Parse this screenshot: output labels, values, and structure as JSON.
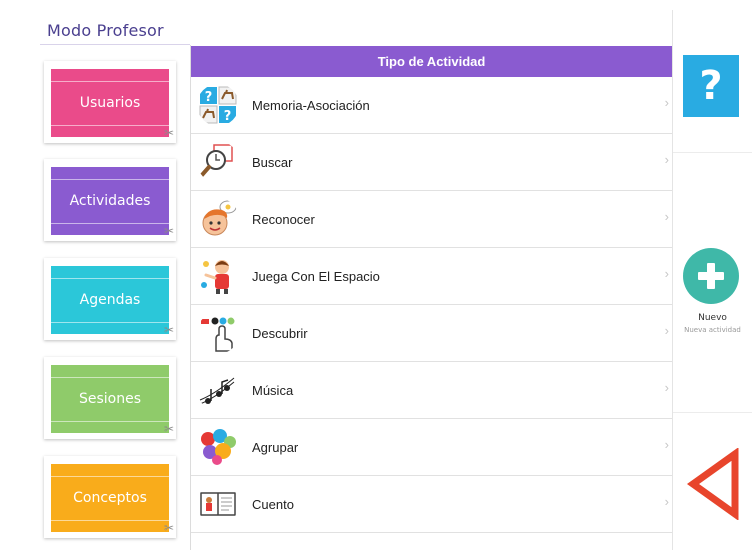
{
  "app": {
    "title": "Modo Profesor"
  },
  "sidebar": {
    "items": [
      {
        "label": "Usuarios",
        "color": "#ea4b8a"
      },
      {
        "label": "Actividades",
        "color": "#8a5bd0"
      },
      {
        "label": "Agendas",
        "color": "#2bc7d9"
      },
      {
        "label": "Sesiones",
        "color": "#8fcb6a"
      },
      {
        "label": "Conceptos",
        "color": "#f9ac1b"
      }
    ]
  },
  "list": {
    "header": "Tipo de Actividad",
    "rows": [
      {
        "label": "Memoria-Asociación",
        "icon": "memory-icon"
      },
      {
        "label": "Buscar",
        "icon": "magnifier-icon"
      },
      {
        "label": "Reconocer",
        "icon": "thinking-child-icon"
      },
      {
        "label": "Juega Con El Espacio",
        "icon": "child-pointing-icon"
      },
      {
        "label": "Descubrir",
        "icon": "hand-pointer-icon"
      },
      {
        "label": "Música",
        "icon": "music-notes-icon"
      },
      {
        "label": "Agrupar",
        "icon": "color-groups-icon"
      },
      {
        "label": "Cuento",
        "icon": "storybook-icon"
      }
    ]
  },
  "actions": {
    "help_label": "?",
    "new_label": "Nuevo",
    "new_sublabel": "Nueva actividad"
  },
  "colors": {
    "header": "#8a5bd0",
    "help": "#29abe2",
    "new": "#3fb8a8",
    "back": "#e8452c",
    "title": "#4a3f8f"
  }
}
